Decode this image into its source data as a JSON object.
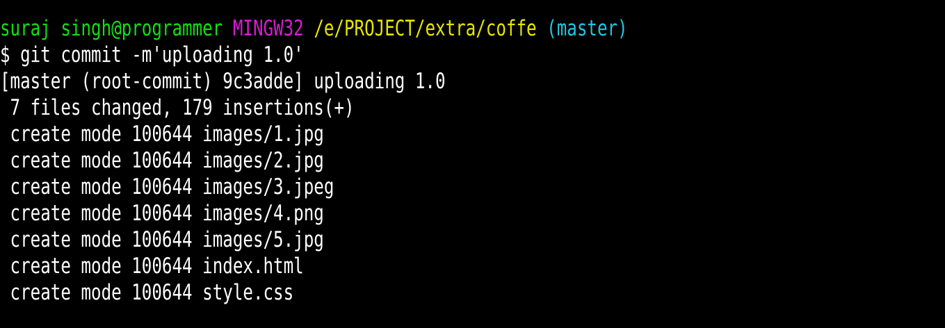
{
  "prompt": {
    "user_host": "suraj singh@programmer",
    "system": "MINGW32",
    "path": "/e/PROJECT/extra/coffe",
    "branch": "(master)"
  },
  "command_line": "$ git commit -m'uploading 1.0'",
  "output": [
    "[master (root-commit) 9c3adde] uploading 1.0",
    " 7 files changed, 179 insertions(+)",
    " create mode 100644 images/1.jpg",
    " create mode 100644 images/2.jpg",
    " create mode 100644 images/3.jpeg",
    " create mode 100644 images/4.png",
    " create mode 100644 images/5.jpg",
    " create mode 100644 index.html",
    " create mode 100644 style.css"
  ],
  "colors": {
    "background": "#000000",
    "text": "#ffffff",
    "user_host": "#10e010",
    "system": "#d81bd8",
    "path": "#e6e600",
    "branch": "#1ec6e0"
  }
}
